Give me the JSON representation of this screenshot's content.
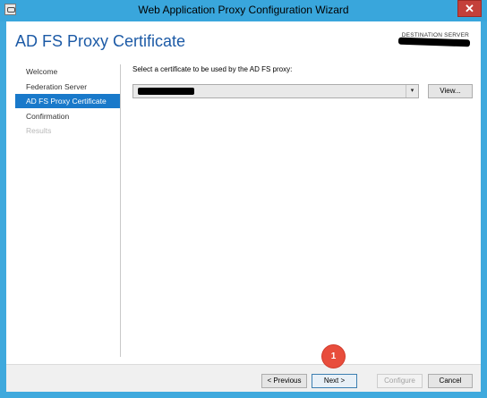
{
  "window": {
    "title": "Web Application Proxy Configuration Wizard",
    "close_label": "✕"
  },
  "page": {
    "title": "AD FS Proxy Certificate",
    "destination_label": "DESTINATION SERVER"
  },
  "nav": {
    "items": [
      {
        "label": "Welcome",
        "state": "normal"
      },
      {
        "label": "Federation Server",
        "state": "normal"
      },
      {
        "label": "AD FS Proxy Certificate",
        "state": "active"
      },
      {
        "label": "Confirmation",
        "state": "normal"
      },
      {
        "label": "Results",
        "state": "disabled"
      }
    ]
  },
  "content": {
    "prompt": "Select a certificate to be used by the AD FS proxy:",
    "dropdown_arrow": "▾",
    "view_label": "View..."
  },
  "footer": {
    "previous_label": "< Previous",
    "next_label": "Next >",
    "configure_label": "Configure",
    "cancel_label": "Cancel"
  },
  "annotation": {
    "badge_text": "1"
  },
  "colors": {
    "title_bar": "#39a6dc",
    "page_title": "#1c5aa6",
    "nav_active": "#1979ca",
    "badge": "#e84d3c"
  }
}
